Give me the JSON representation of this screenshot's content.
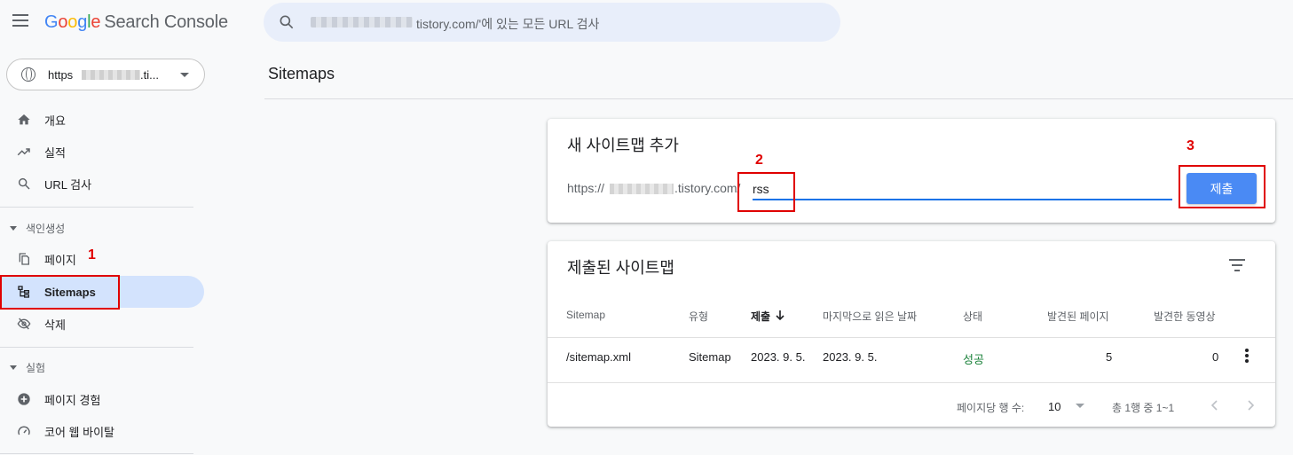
{
  "header": {
    "logo_letters": [
      "G",
      "o",
      "o",
      "g",
      "l",
      "e"
    ],
    "product": "Search Console",
    "search_text": "tistory.com/'에 있는 모든 URL 검사"
  },
  "sidebar": {
    "property_prefix": "https",
    "property_suffix": ".ti...",
    "items": [
      {
        "label": "개요",
        "icon": "home-icon"
      },
      {
        "label": "실적",
        "icon": "trending-up-icon"
      },
      {
        "label": "URL 검사",
        "icon": "search-icon"
      }
    ],
    "section_indexing": "색인생성",
    "indexing_items": [
      {
        "label": "페이지",
        "icon": "pages-icon"
      },
      {
        "label": "Sitemaps",
        "icon": "sitemap-icon",
        "active": true
      },
      {
        "label": "삭제",
        "icon": "visibility-off-icon"
      }
    ],
    "section_experience": "실험",
    "experience_items": [
      {
        "label": "페이지 경험",
        "icon": "add-circle-icon"
      },
      {
        "label": "코어 웹 바이탈",
        "icon": "speed-icon"
      }
    ]
  },
  "main": {
    "page_title": "Sitemaps",
    "add_card": {
      "title": "새 사이트맵 추가",
      "prefix": "https://",
      "suffix": ".tistory.com/",
      "input_value": "rss",
      "submit_label": "제출"
    },
    "submitted_card": {
      "title": "제출된 사이트맵",
      "columns": [
        "Sitemap",
        "유형",
        "제출",
        "마지막으로 읽은 날짜",
        "상태",
        "발견된 페이지",
        "발견한 동영상"
      ],
      "rows": [
        {
          "sitemap": "/sitemap.xml",
          "type": "Sitemap",
          "submitted": "2023. 9. 5.",
          "last_read": "2023. 9. 5.",
          "status": "성공",
          "pages": "5",
          "videos": "0"
        }
      ],
      "rows_per_page_label": "페이지당 행 수:",
      "rows_per_page_value": "10",
      "range_text": "총 1행 중 1~1"
    }
  },
  "annotations": [
    "1",
    "2",
    "3"
  ],
  "colors": {
    "accent": "#1a73e8",
    "button": "#4a8af4",
    "active_nav": "#d3e3fd",
    "success": "#188038",
    "annotation": "#e00000"
  }
}
